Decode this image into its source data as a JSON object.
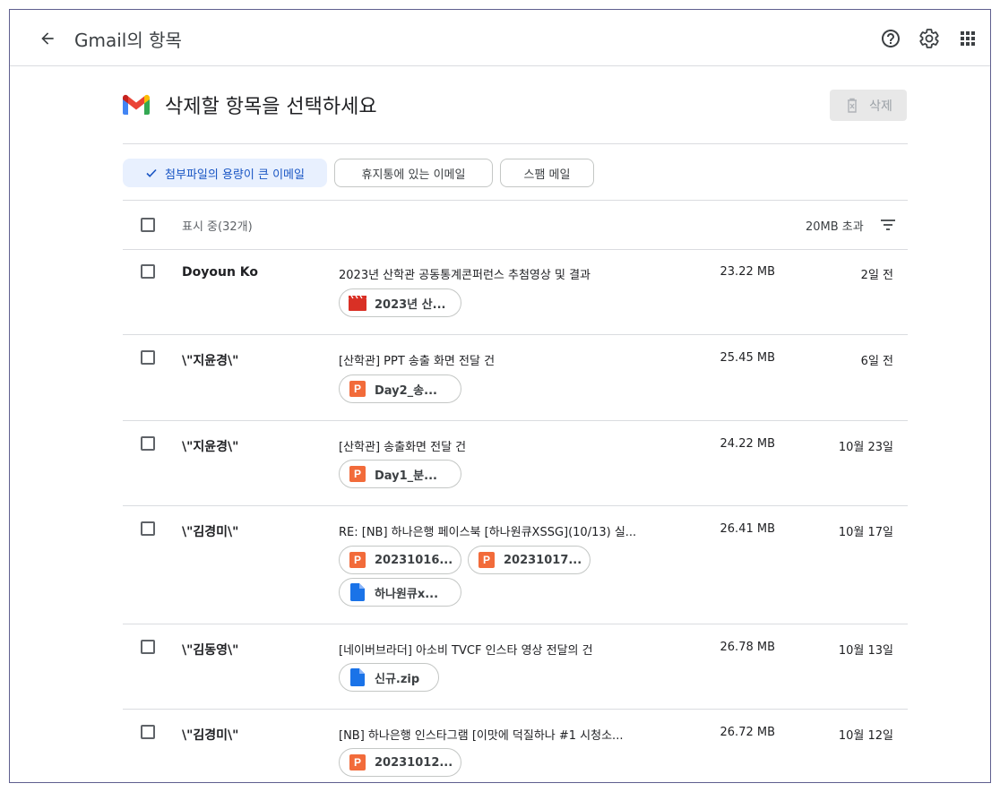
{
  "topbar": {
    "title": "Gmail의 항목"
  },
  "header": {
    "title": "삭제할 항목을 선택하세요",
    "delete_label": "삭제"
  },
  "chips": [
    {
      "label": "첨부파일의 용량이 큰 이메일",
      "selected": true
    },
    {
      "label": "휴지통에 있는 이메일",
      "selected": false
    },
    {
      "label": "스팸 메일",
      "selected": false
    }
  ],
  "list": {
    "count_label": "표시 중(32개)",
    "size_filter_label": "20MB 초과"
  },
  "rows": [
    {
      "sender": "Doyoun Ko",
      "subject": "2023년 산학관 공동통계콘퍼런스 추첨영상 및 결과",
      "size": "23.22 MB",
      "date": "2일 전",
      "attachments": [
        {
          "name": "2023년 산...",
          "icon": "video-file-icon"
        }
      ]
    },
    {
      "sender": "\\\"지윤경\\\"",
      "subject": "[산학관] PPT 송출 화면 전달 건",
      "size": "25.45 MB",
      "date": "6일 전",
      "attachments": [
        {
          "name": "Day2_송...",
          "icon": "ppt-file-icon"
        }
      ]
    },
    {
      "sender": "\\\"지윤경\\\"",
      "subject": "[산학관] 송출화면 전달 건",
      "size": "24.22 MB",
      "date": "10월 23일",
      "attachments": [
        {
          "name": "Day1_분...",
          "icon": "ppt-file-icon"
        }
      ]
    },
    {
      "sender": "\\\"김경미\\\"",
      "subject": "RE: [NB] 하나은행 페이스북 [하나원큐XSSG](10/13) 실...",
      "size": "26.41 MB",
      "date": "10월 17일",
      "attachments": [
        {
          "name": "20231016...",
          "icon": "ppt-file-icon"
        },
        {
          "name": "20231017...",
          "icon": "ppt-file-icon"
        },
        {
          "name": "하나원큐x...",
          "icon": "doc-file-icon"
        }
      ]
    },
    {
      "sender": "\\\"김동영\\\"",
      "subject": "[네이버브라더] 아소비 TVCF 인스타 영상 전달의 건",
      "size": "26.78 MB",
      "date": "10월 13일",
      "attachments": [
        {
          "name": "신규.zip",
          "icon": "doc-file-icon"
        }
      ]
    },
    {
      "sender": "\\\"김경미\\\"",
      "subject": "[NB] 하나은행 인스타그램 [이맛에 덕질하나 #1 시청소...",
      "size": "26.72 MB",
      "date": "10월 12일",
      "attachments": [
        {
          "name": "20231012...",
          "icon": "ppt-file-icon"
        }
      ]
    }
  ],
  "colors": {
    "accent": "#1a73e8",
    "chip_selected_bg": "#e8f0fe",
    "ppt": "#f26b3a",
    "video": "#d93025"
  }
}
